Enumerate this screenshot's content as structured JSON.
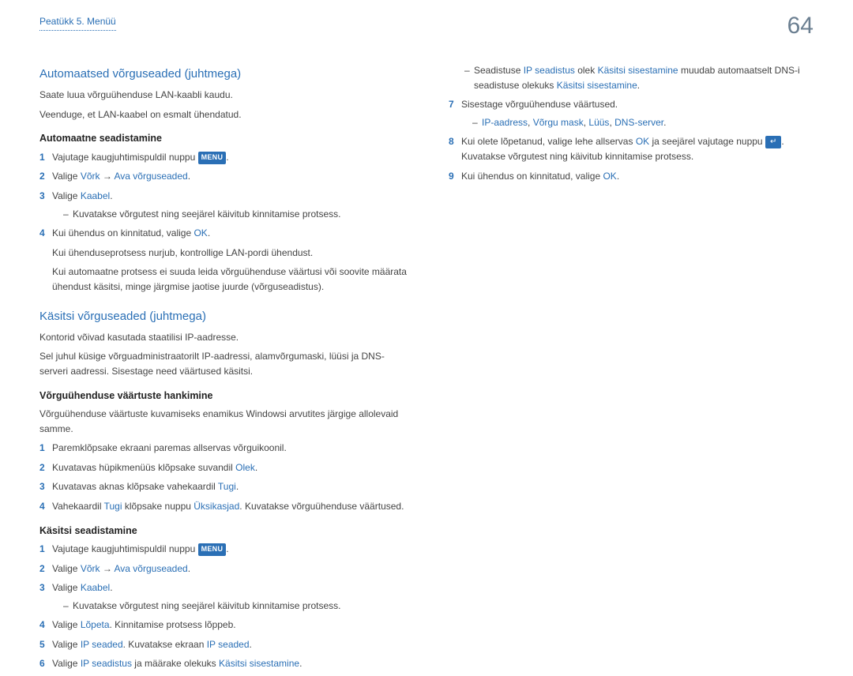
{
  "header": {
    "breadcrumb": "Peatükk 5. Menüü",
    "page_number": "64"
  },
  "left": {
    "section1": {
      "heading": "Automaatsed võrguseaded (juhtmega)",
      "p1": "Saate luua võrguühenduse LAN-kaabli kaudu.",
      "p2": "Veenduge, et LAN-kaabel on esmalt ühendatud.",
      "sub_heading": "Automaatne seadistamine",
      "step1_a": "Vajutage kaugjuhtimispuldil nuppu ",
      "menu_badge": "MENU",
      "step1_b": ".",
      "step2_a": "Valige ",
      "step2_b": "Võrk",
      "step2_sep": " → ",
      "step2_c": "Ava võrguseaded",
      "step2_d": ".",
      "step3_a": "Valige ",
      "step3_b": "Kaabel",
      "step3_c": ".",
      "step3_sub": "Kuvatakse võrgutest ning seejärel käivitub kinnitamise protsess.",
      "step4_a": "Kui ühendus on kinnitatud, valige ",
      "step4_b": "OK",
      "step4_c": ".",
      "note1": "Kui ühenduseprotsess nurjub, kontrollige LAN-pordi ühendust.",
      "note2": "Kui automaatne protsess ei suuda leida võrguühenduse väärtusi või soovite määrata ühendust käsitsi, minge järgmise jaotise juurde (võrguseadistus)."
    },
    "section2": {
      "heading": "Käsitsi võrguseaded (juhtmega)",
      "p1": "Kontorid võivad kasutada staatilisi IP-aadresse.",
      "p2": "Sel juhul küsige võrguadministraatorilt IP-aadressi, alamvõrgumaski, lüüsi ja DNS-serveri aadressi. Sisestage need väärtused käsitsi.",
      "sub_heading1": "Võrguühenduse väärtuste hankimine",
      "p3": "Võrguühenduse väärtuste kuvamiseks enamikus Windowsi arvutites järgige allolevaid samme.",
      "vh_step1": "Paremklõpsake ekraani paremas allservas võrguikoonil.",
      "vh_step2_a": "Kuvatavas hüpikmenüüs klõpsake suvandil ",
      "vh_step2_b": "Olek",
      "vh_step2_c": ".",
      "vh_step3_a": "Kuvatavas aknas klõpsake vahekaardil ",
      "vh_step3_b": "Tugi",
      "vh_step3_c": ".",
      "vh_step4_a": "Vahekaardil ",
      "vh_step4_b": "Tugi",
      "vh_step4_c": " klõpsake nuppu ",
      "vh_step4_d": "Üksikasjad",
      "vh_step4_e": ". Kuvatakse võrguühenduse väärtused.",
      "sub_heading2": "Käsitsi seadistamine",
      "ks_step1_a": "Vajutage kaugjuhtimispuldil nuppu ",
      "ks_step1_b": ".",
      "ks_step2_a": "Valige ",
      "ks_step2_b": "Võrk",
      "ks_step2_sep": " → ",
      "ks_step2_c": "Ava võrguseaded",
      "ks_step2_d": ".",
      "ks_step3_a": "Valige ",
      "ks_step3_b": "Kaabel",
      "ks_step3_c": ".",
      "ks_step3_sub": "Kuvatakse võrgutest ning seejärel käivitub kinnitamise protsess.",
      "ks_step4_a": "Valige ",
      "ks_step4_b": "Lõpeta",
      "ks_step4_c": ". Kinnitamise protsess lõppeb.",
      "ks_step5_a": "Valige ",
      "ks_step5_b": "IP seaded",
      "ks_step5_c": ". Kuvatakse ekraan ",
      "ks_step5_d": "IP seaded",
      "ks_step5_e": ".",
      "ks_step6_a": "Valige ",
      "ks_step6_b": "IP seadistus",
      "ks_step6_c": " ja määrake olekuks ",
      "ks_step6_d": "Käsitsi sisestamine",
      "ks_step6_e": "."
    }
  },
  "right": {
    "bullet_a": "Seadistuse ",
    "bullet_b": "IP seadistus",
    "bullet_c": " olek ",
    "bullet_d": "Käsitsi sisestamine",
    "bullet_e": " muudab automaatselt DNS-i seadistuse olekuks ",
    "bullet_f": "Käsitsi sisestamine",
    "bullet_g": ".",
    "step7": "Sisestage võrguühenduse väärtused.",
    "step7_sub_a": "IP-aadress",
    "step7_sub_sep1": ", ",
    "step7_sub_b": "Võrgu mask",
    "step7_sub_sep2": ", ",
    "step7_sub_c": "Lüüs",
    "step7_sub_sep3": ", ",
    "step7_sub_d": "DNS-server",
    "step7_sub_e": ".",
    "step8_a": "Kui olete lõpetanud, valige lehe allservas ",
    "step8_b": "OK",
    "step8_c": " ja seejärel vajutage nuppu ",
    "step8_icon": "↵",
    "step8_d": ". Kuvatakse võrgutest ning käivitub kinnitamise protsess.",
    "step9_a": "Kui ühendus on kinnitatud, valige ",
    "step9_b": "OK",
    "step9_c": "."
  }
}
